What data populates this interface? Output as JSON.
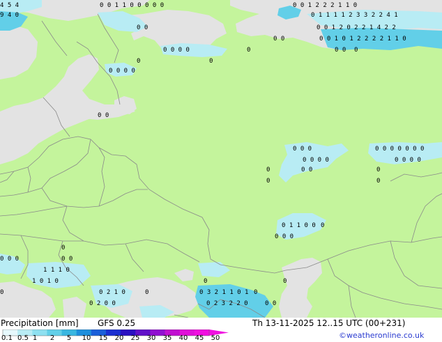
{
  "map": {
    "colors": {
      "land": "#c4f49c",
      "sea": "#e3e3e3",
      "border": "#8a8a8a",
      "precip_light": "#b8ecf4",
      "precip_medium": "#62cfe8"
    },
    "value_rows": [
      {
        "text": "4 5 4",
        "icon": "number-row"
      },
      {
        "text": "0 0 1 1 0 0 0 0 0",
        "icon": "number-row"
      },
      {
        "text": "0 0 1 2 2 2 1 1 0",
        "icon": "number-row"
      },
      {
        "text": "0 1 1 1 1 2 3 3 2 2 4 1",
        "icon": "number-row"
      },
      {
        "text": "9 4 0",
        "icon": "number-row"
      },
      {
        "text": "0 0",
        "icon": "number-row"
      },
      {
        "text": "0 0 1 2 0 2 2 1 4 2 2",
        "icon": "number-row"
      },
      {
        "text": "0 0 1 0 1 2 2 2 2 1 1 0",
        "icon": "number-row"
      },
      {
        "text": "0 0 0 0",
        "icon": "number-row"
      },
      {
        "text": "0 0",
        "icon": "number-row"
      },
      {
        "text": "0",
        "icon": "number-row"
      },
      {
        "text": "0",
        "icon": "number-row"
      },
      {
        "text": "0 0",
        "icon": "number-row"
      },
      {
        "text": "0",
        "icon": "number-row"
      },
      {
        "text": "0 0 0 0",
        "icon": "number-row"
      },
      {
        "text": "0 0",
        "icon": "number-row"
      },
      {
        "text": "0",
        "icon": "number-row"
      },
      {
        "text": "0 0 0",
        "icon": "number-row"
      },
      {
        "text": "0 0 0 0 0 0 0",
        "icon": "number-row"
      },
      {
        "text": "0 0 0 0",
        "icon": "number-row"
      },
      {
        "text": "0 0 0 0",
        "icon": "number-row"
      },
      {
        "text": "0",
        "icon": "number-row"
      },
      {
        "text": "0 0",
        "icon": "number-row"
      },
      {
        "text": "0",
        "icon": "number-row"
      },
      {
        "text": "0",
        "icon": "number-row"
      },
      {
        "text": "0",
        "icon": "number-row"
      },
      {
        "text": "0 1 1 0 0",
        "icon": "number-row"
      },
      {
        "text": "0 0 0",
        "icon": "number-row"
      },
      {
        "text": "0",
        "icon": "number-row"
      },
      {
        "text": "0",
        "icon": "number-row"
      },
      {
        "text": "0 0",
        "icon": "number-row"
      },
      {
        "text": "1 1 1 0",
        "icon": "number-row"
      },
      {
        "text": "0 0 0",
        "icon": "number-row"
      },
      {
        "text": "1 0 1 0",
        "icon": "number-row"
      },
      {
        "text": "0",
        "icon": "number-row"
      },
      {
        "text": "0 2 1 0",
        "icon": "number-row"
      },
      {
        "text": "0",
        "icon": "number-row"
      },
      {
        "text": "0 2 0 0",
        "icon": "number-row"
      },
      {
        "text": "0 3 2 1 1 0 1",
        "icon": "number-row"
      },
      {
        "text": "0 2 3 2 2 0",
        "icon": "number-row"
      },
      {
        "text": "0 0",
        "icon": "number-row"
      },
      {
        "text": "0",
        "icon": "number-row"
      },
      {
        "text": "0",
        "icon": "number-row"
      },
      {
        "text": "0",
        "icon": "number-row"
      }
    ]
  },
  "footer": {
    "title": "Precipitation [mm]",
    "model": "GFS 0.25",
    "datetime": "Th 13-11-2025 12..15 UTC (00+231)",
    "credit": "©weatheronline.co.uk"
  },
  "colorbar": {
    "labels": [
      "0.1",
      "0.5",
      "1",
      "2",
      "5",
      "10",
      "15",
      "20",
      "25",
      "30",
      "35",
      "40",
      "45",
      "50"
    ],
    "colors": [
      "#e6f8fc",
      "#b8ecf4",
      "#8ee0f0",
      "#62cfe8",
      "#3ab6e0",
      "#1e8edc",
      "#1a5ed8",
      "#1a2ed0",
      "#2a10c0",
      "#6010c8",
      "#9010d0",
      "#c010d0",
      "#e010d8",
      "#f010e0"
    ]
  }
}
